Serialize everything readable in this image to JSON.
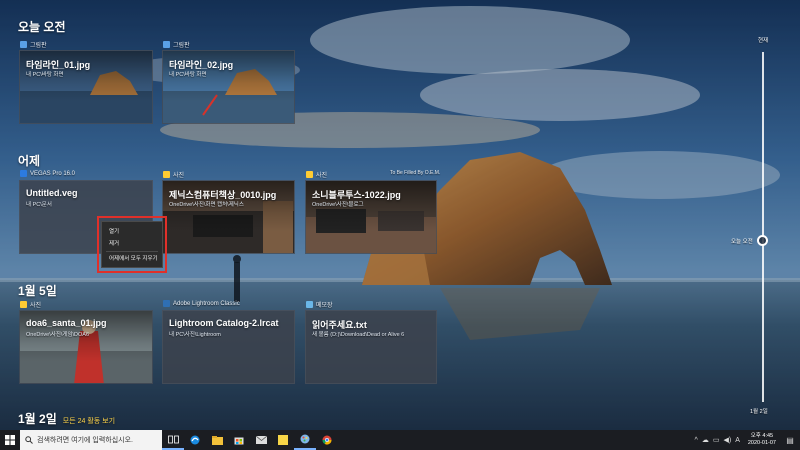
{
  "colors": {
    "sky_top": "#1a3a66",
    "sky_mid": "#4f84b8",
    "sea": "#25425e",
    "card_bg": "#373e48",
    "menu_bg": "#2b2b2b",
    "highlight": "#e0302a",
    "taskbar": "#1b1d22",
    "accent_yellow": "#ffd54a"
  },
  "sections": {
    "today": {
      "title": "오늘 오전"
    },
    "yesterday": {
      "title": "어제"
    },
    "jan5": {
      "title": "1월 5일"
    },
    "jan2": {
      "title": "1월 2일",
      "sub": "모든 24 활동 보기"
    }
  },
  "cards": {
    "today_1": {
      "app": "그림판",
      "app_icon": "paint-icon",
      "title": "타임라인_01.jpg",
      "sub": "내 PC\\바탕 화면"
    },
    "today_2": {
      "app": "그림판",
      "app_icon": "paint-icon",
      "title": "타임라인_02.jpg",
      "sub": "내 PC\\바탕 화면"
    },
    "yest_1": {
      "app": "VEGAS Pro 16.0",
      "app_icon": "vegas-icon",
      "title": "Untitled.veg",
      "sub": "내 PC\\문서"
    },
    "yest_2": {
      "app": "사진",
      "app_icon": "photos-icon",
      "title": "제닉스컴퓨터책상_0010.jpg",
      "sub": "OneDrive\\사진\\화면 캡처\\제닉스"
    },
    "yest_3": {
      "app": "사진",
      "app_icon": "photos-icon",
      "title": "소니블루투스-1022.jpg",
      "sub": "OneDrive\\사진\\블로그",
      "corner": "To Be Filled By O.E.M."
    },
    "jan5_1": {
      "app": "사진",
      "app_icon": "photos-icon",
      "title": "doa6_santa_01.jpg",
      "sub": "OneDrive\\사진\\게임\\DOA6"
    },
    "jan5_2": {
      "app": "Adobe Lightroom Classic",
      "app_icon": "lightroom-icon",
      "title": "Lightroom Catalog-2.lrcat",
      "sub": "내 PC\\사진\\Lightroom"
    },
    "jan5_3": {
      "app": "메모장",
      "app_icon": "notepad-icon",
      "title": "읽어주세요.txt",
      "sub": "새 볼륨 (D:)\\Download\\Dead or Alive 6"
    }
  },
  "context_menu": {
    "items": [
      "열기",
      "제거",
      "어제에서 모두 지우기"
    ]
  },
  "scrubber": {
    "top_label": "현재",
    "mid_label": "오늘 오전",
    "bottom_label": "1월 2일"
  },
  "taskbar": {
    "search_placeholder": "검색하려면 여기에 입력하십시오.",
    "time": "오후 4:45",
    "date": "2020-01-07",
    "pinned_icons": [
      "task-view-icon",
      "edge-icon",
      "file-explorer-icon",
      "store-icon",
      "mail-icon",
      "sticky-notes-icon",
      "paint-icon",
      "chrome-icon"
    ]
  }
}
